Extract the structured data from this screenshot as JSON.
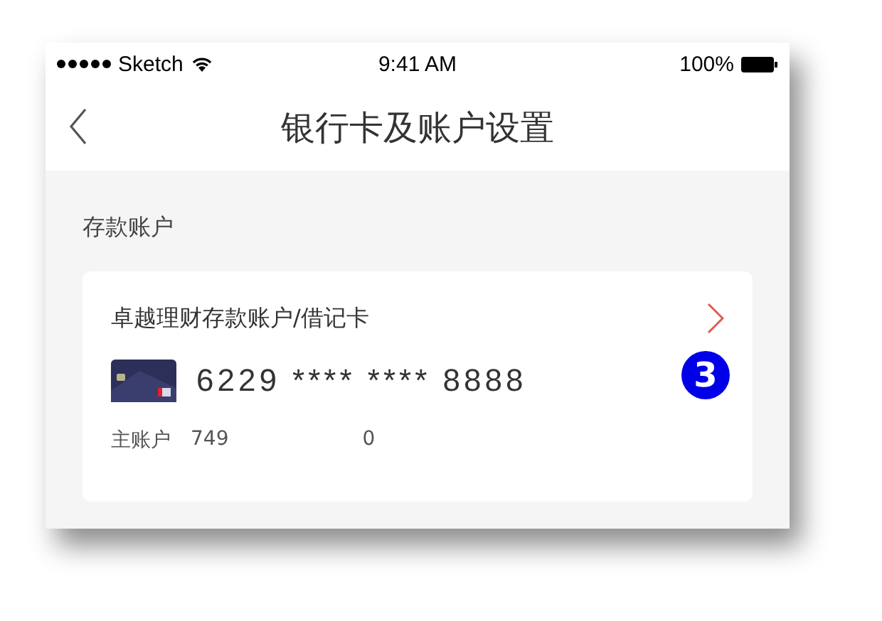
{
  "status_bar": {
    "carrier": "Sketch",
    "time": "9:41 AM",
    "battery": "100%"
  },
  "nav": {
    "title": "银行卡及账户设置"
  },
  "section": {
    "title": "存款账户"
  },
  "account_card": {
    "name": "卓越理财存款账户/借记卡",
    "badge": "3",
    "card_number": "6229 **** **** 8888",
    "main_label": "主账户",
    "main_number_parts": [
      "749",
      "0"
    ]
  }
}
